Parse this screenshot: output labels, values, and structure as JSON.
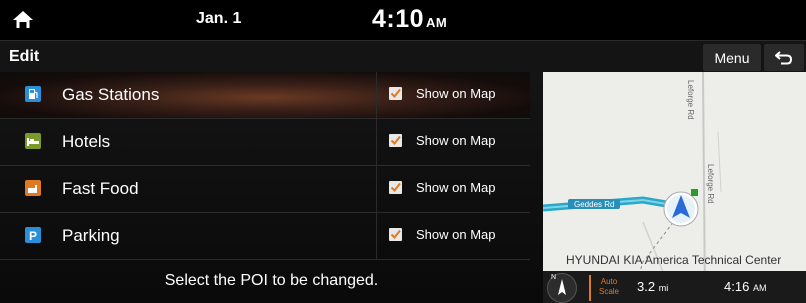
{
  "status_bar": {
    "date": "Jan. 1",
    "time": "4:10",
    "ampm": "AM"
  },
  "header": {
    "title": "Edit",
    "menu_label": "Menu"
  },
  "poi_list": [
    {
      "label": "Gas Stations",
      "checkbox_label": "Show on Map",
      "checked": true,
      "icon": "gas-station-icon",
      "color": "#2a8fd8"
    },
    {
      "label": "Hotels",
      "checkbox_label": "Show on Map",
      "checked": true,
      "icon": "hotel-bed-icon",
      "color": "#7a9a2a"
    },
    {
      "label": "Fast Food",
      "checkbox_label": "Show on Map",
      "checked": true,
      "icon": "fast-food-icon",
      "color": "#e07a20"
    },
    {
      "label": "Parking",
      "checkbox_label": "Show on Map",
      "checked": true,
      "icon": "parking-icon",
      "color": "#2a8fd8"
    }
  ],
  "hint": "Select the POI to be changed.",
  "map": {
    "road_labels": [
      "Leforge Rd",
      "Leforge Rd",
      "Geddes Rd"
    ],
    "place_label": "HYUNDAI KIA America Technical Center",
    "route_color": "#2aa8c8",
    "scale_label": "Auto\nScale",
    "distance": "3.2",
    "distance_unit": "mi",
    "eta": "4:16",
    "eta_unit": "AM",
    "compass_label": "N"
  }
}
